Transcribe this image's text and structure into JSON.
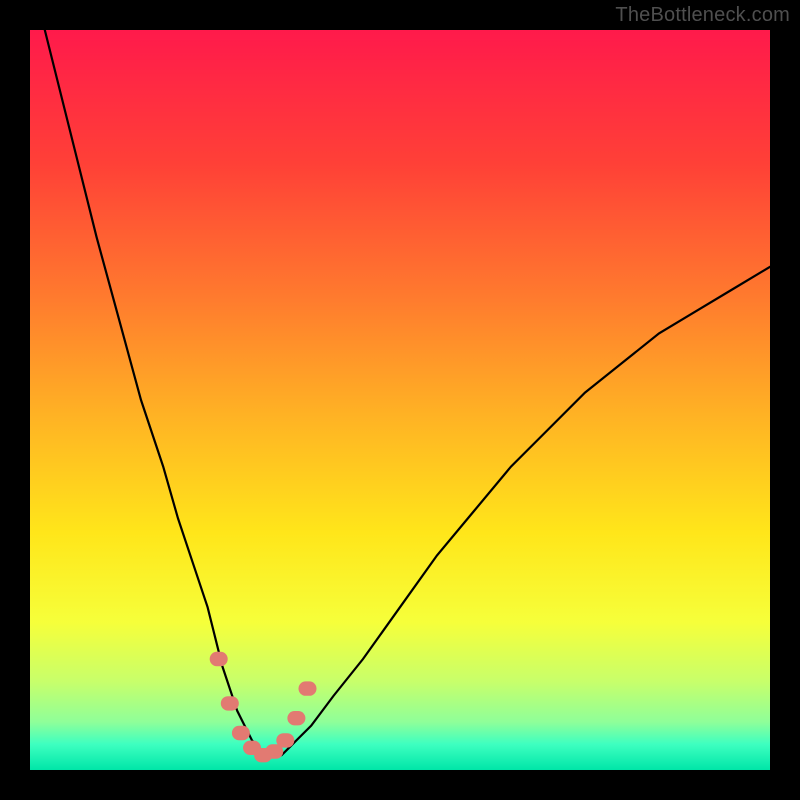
{
  "watermark": "TheBottleneck.com",
  "gradient": {
    "stops": [
      {
        "offset": 0.0,
        "color": "#ff1a4b"
      },
      {
        "offset": 0.18,
        "color": "#ff4037"
      },
      {
        "offset": 0.36,
        "color": "#ff7a2e"
      },
      {
        "offset": 0.52,
        "color": "#ffb224"
      },
      {
        "offset": 0.68,
        "color": "#ffe61a"
      },
      {
        "offset": 0.8,
        "color": "#f6ff3a"
      },
      {
        "offset": 0.88,
        "color": "#c8ff6a"
      },
      {
        "offset": 0.935,
        "color": "#8fff99"
      },
      {
        "offset": 0.965,
        "color": "#3effc0"
      },
      {
        "offset": 1.0,
        "color": "#00e6a8"
      }
    ]
  },
  "chart_data": {
    "type": "line",
    "title": "",
    "xlabel": "",
    "ylabel": "",
    "xlim": [
      0,
      100
    ],
    "ylim": [
      0,
      100
    ],
    "x": [
      0,
      3,
      6,
      9,
      12,
      15,
      18,
      20,
      22,
      24,
      25,
      26,
      27,
      28,
      29,
      30,
      31,
      32,
      33,
      34,
      35,
      36,
      38,
      41,
      45,
      50,
      55,
      60,
      65,
      70,
      75,
      80,
      85,
      90,
      95,
      100
    ],
    "values": [
      108,
      96,
      84,
      72,
      61,
      50,
      41,
      34,
      28,
      22,
      18,
      14,
      11,
      8,
      6,
      4,
      3,
      2,
      2,
      2,
      3,
      4,
      6,
      10,
      15,
      22,
      29,
      35,
      41,
      46,
      51,
      55,
      59,
      62,
      65,
      68
    ],
    "markers": {
      "x": [
        25.5,
        27.0,
        28.5,
        30.0,
        31.5,
        33.0,
        34.5,
        36.0,
        37.5
      ],
      "y": [
        15.0,
        9.0,
        5.0,
        3.0,
        2.0,
        2.5,
        4.0,
        7.0,
        11.0
      ],
      "color": "#e27a72",
      "size": 9
    }
  }
}
